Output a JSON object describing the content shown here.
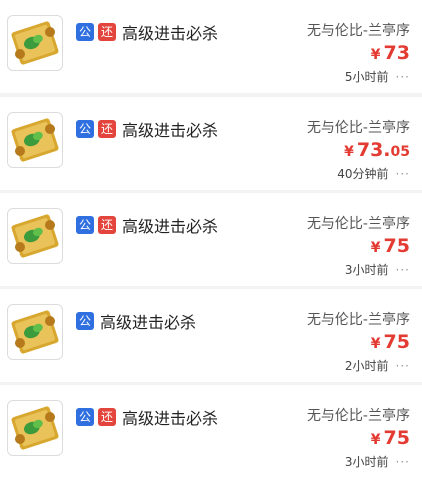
{
  "items": [
    {
      "badges": [
        "公",
        "还"
      ],
      "title": "高级进击必杀",
      "server": "无与伦比-兰亭序",
      "currency": "¥",
      "price_int": "73",
      "price_dec": "",
      "time": "5小时前",
      "more": "···"
    },
    {
      "badges": [
        "公",
        "还"
      ],
      "title": "高级进击必杀",
      "server": "无与伦比-兰亭序",
      "currency": "¥",
      "price_int": "73.",
      "price_dec": "05",
      "time": "40分钟前",
      "more": "···"
    },
    {
      "badges": [
        "公",
        "还"
      ],
      "title": "高级进击必杀",
      "server": "无与伦比-兰亭序",
      "currency": "¥",
      "price_int": "75",
      "price_dec": "",
      "time": "3小时前",
      "more": "···"
    },
    {
      "badges": [
        "公"
      ],
      "title": "高级进击必杀",
      "server": "无与伦比-兰亭序",
      "currency": "¥",
      "price_int": "75",
      "price_dec": "",
      "time": "2小时前",
      "more": "···"
    },
    {
      "badges": [
        "公",
        "还"
      ],
      "title": "高级进击必杀",
      "server": "无与伦比-兰亭序",
      "currency": "¥",
      "price_int": "75",
      "price_dec": "",
      "time": "3小时前",
      "more": "···"
    }
  ],
  "icons": {
    "item_icon": "scroll-icon",
    "more_icon": "more-dots-icon"
  },
  "colors": {
    "gong_badge": "#2f6fe0",
    "huan_badge": "#e3443b",
    "price": "#e33a32"
  }
}
